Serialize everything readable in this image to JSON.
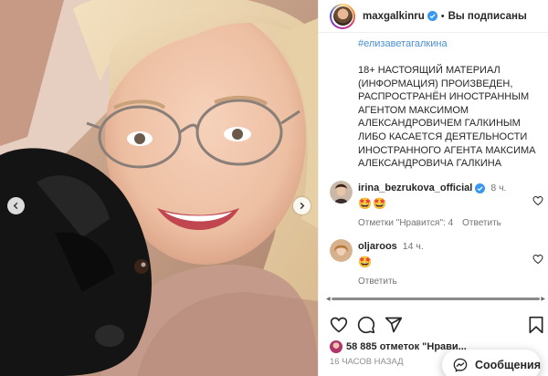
{
  "header": {
    "username": "maxgalkinru",
    "separator": "•",
    "follow_state": "Вы подписаны"
  },
  "caption": {
    "hashtag": "#елизаветагалкина",
    "text": "18+ НАСТОЯЩИЙ МАТЕРИАЛ\n(ИНФОРМАЦИЯ)  ПРОИЗВЕДЕН,\nРАСПРОСТРАНЁН ИНОСТРАННЫМ\nАГЕНТОМ МАКСИМОМ\nАЛЕКСАНДРОВИЧЕМ ГАЛКИНЫМ\nЛИБО КАСАЕТСЯ ДЕЯТЕЛЬНОСТИ\nИНОСТРАННОГО АГЕНТА МАКСИМА\nАЛЕКСАНДРОВИЧА ГАЛКИНА"
  },
  "comments": [
    {
      "user": "irina_bezrukova_official",
      "verified": true,
      "time": "8 ч.",
      "emoji": "🤩🤩",
      "likes_label": "Отметки \"Нравится\": 4",
      "reply_label": "Ответить"
    },
    {
      "user": "oljaroos",
      "verified": false,
      "time": "14 ч.",
      "emoji": "🤩",
      "reply_label": "Ответить"
    }
  ],
  "likes": {
    "text": "58 885 отметок \"Нрави..."
  },
  "time_ago": "16 ЧАСОВ НАЗАД",
  "messages_button": {
    "label": "Сообщения"
  },
  "colors": {
    "verified_blue": "#3897f0",
    "hashtag": "#00376b",
    "secondary_text": "#737373"
  },
  "icons": [
    "chevron-left-icon",
    "chevron-right-icon",
    "verified-badge-icon",
    "heart-icon",
    "comment-icon",
    "share-icon",
    "bookmark-icon",
    "messenger-icon"
  ]
}
